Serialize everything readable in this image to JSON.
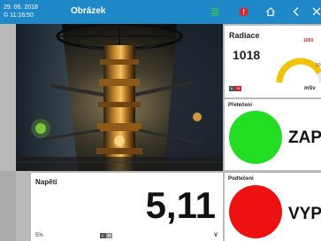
{
  "header": {
    "date": "29. 06. 2018",
    "time": "© 11:16:50",
    "title": "Obrázek",
    "icons": [
      "signal-bars-icon",
      "alert-icon",
      "home-icon",
      "back-icon",
      "close-icon"
    ]
  },
  "viewer": {
    "image_subject": "industrial-tower-image"
  },
  "radiace": {
    "title": "Radiace",
    "value": "1018",
    "gauge_max_label": "1000",
    "gauge_tick_label": "10",
    "unit": "mSv",
    "flag_l": "L",
    "flag_m": "H",
    "gauge_fraction": 0.85,
    "gauge_color": "#f2c200",
    "alarm_color": "#e02020"
  },
  "preteceni": {
    "title": "Přetečení",
    "state": "ZAP",
    "color": "#22dd22"
  },
  "podteceni": {
    "title": "Podtečení",
    "state": "VYP",
    "color": "#ee1111"
  },
  "napeti": {
    "title": "Napětí",
    "value": "5,11",
    "unit": "V",
    "percent": "5%",
    "flag_l": "L",
    "flag_m": "H"
  }
}
